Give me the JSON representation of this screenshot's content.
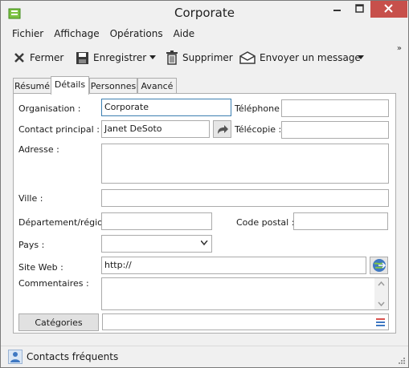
{
  "window": {
    "title": "Corporate"
  },
  "menu": {
    "items": [
      "Fichier",
      "Affichage",
      "Opérations",
      "Aide"
    ]
  },
  "toolbar": {
    "close_label": "Fermer",
    "save_label": "Enregistrer",
    "delete_label": "Supprimer",
    "send_label": "Envoyer un message",
    "overflow": "»"
  },
  "tabs": [
    "Résumé",
    "Détails",
    "Personnes",
    "Avancé"
  ],
  "form": {
    "organisation_label": "Organisation :",
    "organisation_value": "Corporate",
    "telephone_label": "Téléphone :",
    "telephone_value": "",
    "contact_label": "Contact principal :",
    "contact_value": "Janet DeSoto",
    "telecopie_label": "Télécopie :",
    "telecopie_value": "",
    "adresse_label": "Adresse :",
    "adresse_value": "",
    "ville_label": "Ville :",
    "ville_value": "",
    "departement_label": "Département/région :",
    "departement_value": "",
    "code_postal_label": "Code postal :",
    "code_postal_value": "",
    "pays_label": "Pays :",
    "pays_value": "",
    "site_web_label": "Site Web :",
    "site_web_value": "http://",
    "commentaires_label": "Commentaires :",
    "commentaires_value": "",
    "categories_button": "Catégories",
    "categories_value": ""
  },
  "status": {
    "label": "Contacts fréquents"
  },
  "colors": {
    "close_button": "#c7504b",
    "focus_border": "#3c7fb1",
    "panel_border": "#adadad"
  },
  "icons": [
    "address-book-icon",
    "close-x-icon",
    "save-icon",
    "trash-icon",
    "envelope-icon",
    "share-arrow-icon",
    "globe-go-icon",
    "list-icon",
    "contacts-icon"
  ]
}
